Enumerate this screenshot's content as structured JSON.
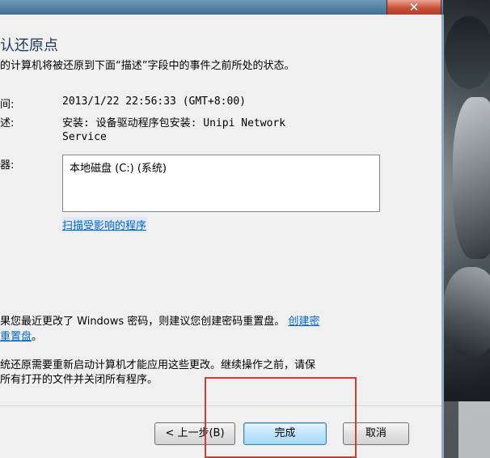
{
  "window": {
    "close_glyph": "✕"
  },
  "header": {
    "title": "确认还原点",
    "intro": "您的计算机将被还原到下面“描述”字段中的事件之前所处的状态。"
  },
  "fields": {
    "time_label": "时间:",
    "time_value": "2013/1/22 22:56:33 (GMT+8:00)",
    "desc_label": "描述:",
    "desc_line1": "安装: 设备驱动程序包安装: Unipi Network",
    "desc_line2": "Service",
    "drives_label": "驱动器:",
    "drives": [
      "本地磁盘 (C:) (系统)"
    ]
  },
  "links": {
    "scan_affected": "扫描受影响的程序"
  },
  "notes": {
    "password_text_1": "如果您最近更改了 Windows 密码，则建议您创建密码重置盘。",
    "password_link_1": "创建密",
    "password_link_2": "码重置盘",
    "password_text_2": "。",
    "restart_line1": "系统还原需要重新启动计算机才能应用这些更改。继续操作之前，请保",
    "restart_line2": "存所有打开的文件并关闭所有程序。"
  },
  "buttons": {
    "back": "< 上一步(B)",
    "finish": "完成",
    "cancel": "取消"
  },
  "colors": {
    "accent": "#1e395b",
    "link": "#0066cc",
    "highlight": "#c9403a"
  }
}
